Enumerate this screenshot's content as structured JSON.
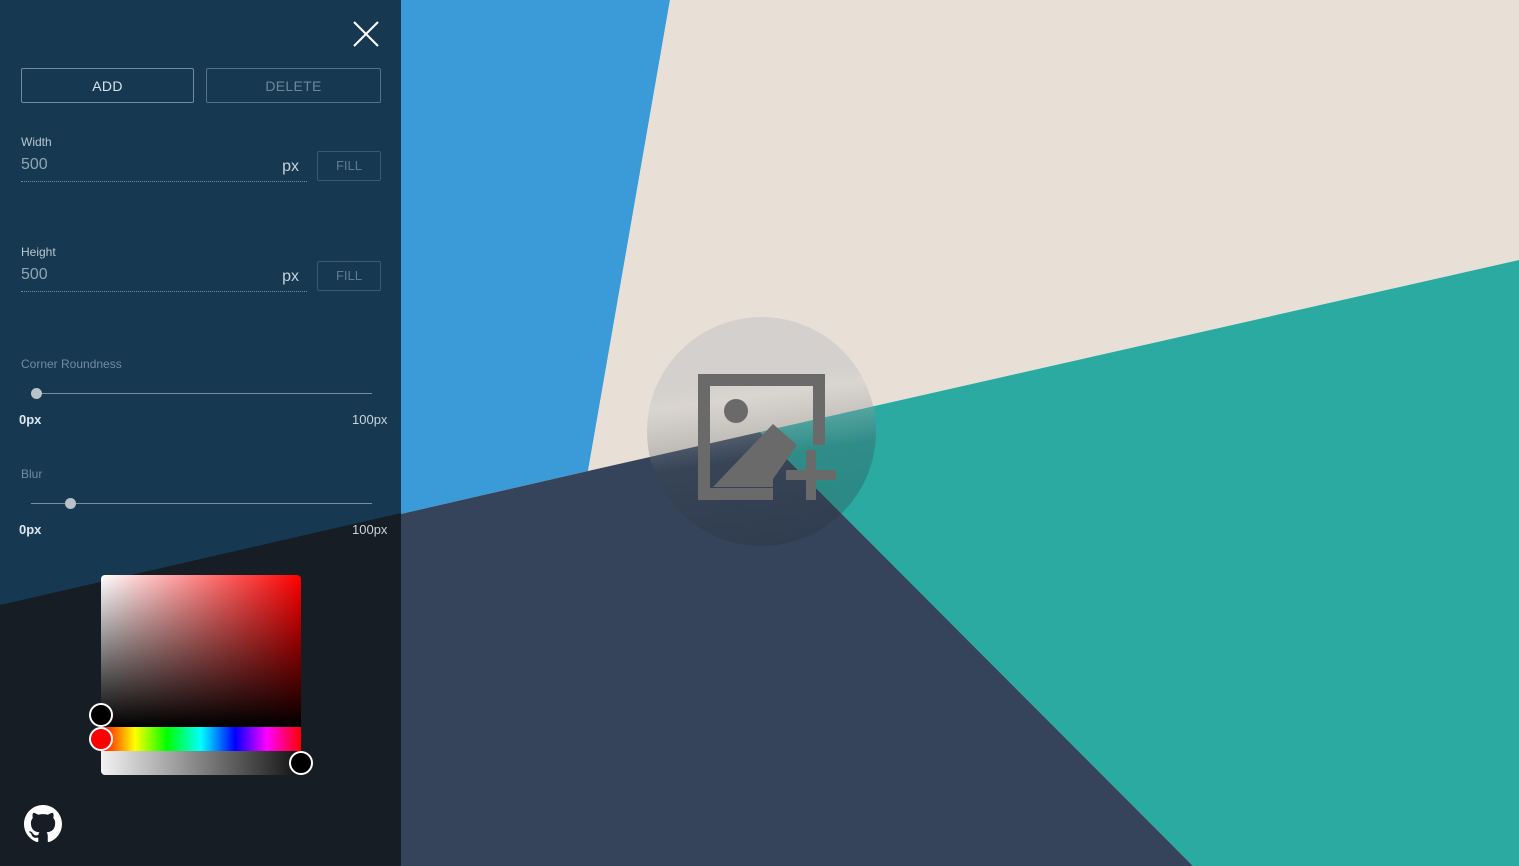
{
  "panel": {
    "add_label": "ADD",
    "delete_label": "DELETE",
    "width": {
      "label": "Width",
      "value": "500",
      "unit": "px",
      "fill_label": "FILL"
    },
    "height": {
      "label": "Height",
      "value": "500",
      "unit": "px",
      "fill_label": "FILL"
    },
    "corner_roundness": {
      "label": "Corner Roundness",
      "min_label": "0px",
      "max_label": "100px",
      "value": 0
    },
    "blur": {
      "label": "Blur",
      "min_label": "0px",
      "max_label": "100px",
      "value": 10
    },
    "color_picker": {
      "hue": 0,
      "saturation": 0,
      "brightness": 0,
      "alpha": 1
    }
  },
  "icons": {
    "close": "close-icon",
    "github": "github-icon",
    "add_image": "add-image-icon"
  },
  "colors": {
    "blue": "#3b9ad8",
    "cream": "#e8e0d7",
    "teal": "#2aaaa0",
    "navy": "#35445a",
    "panel_top": "#163951",
    "panel_bottom": "#171d25"
  }
}
